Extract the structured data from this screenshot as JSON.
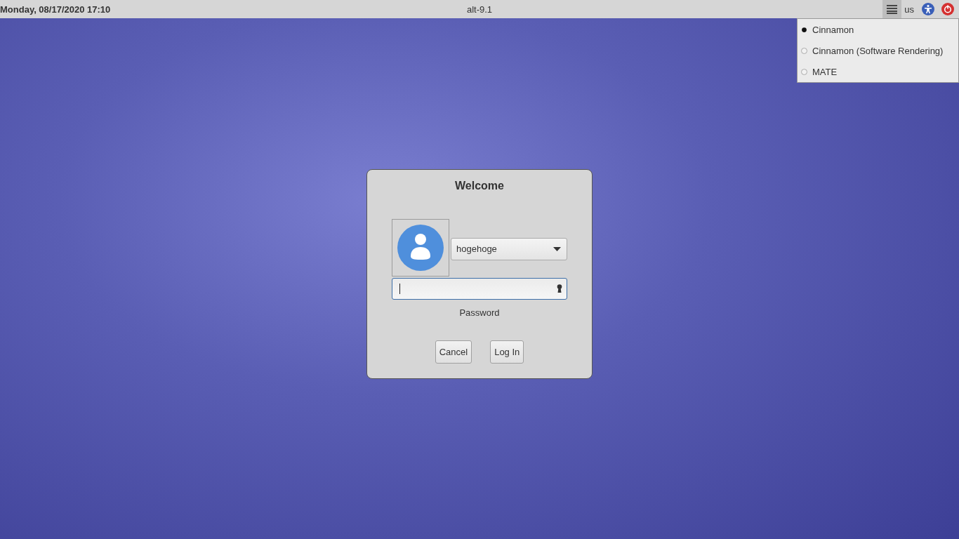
{
  "top_bar": {
    "clock": "Monday, 08/17/2020 17:10",
    "hostname": "alt-9.1",
    "session_menu_button": {
      "expanded": true
    },
    "keyboard_layout": "us"
  },
  "session_menu": {
    "items": [
      {
        "label": "Cinnamon",
        "selected": true
      },
      {
        "label": "Cinnamon (Software Rendering)",
        "selected": false
      },
      {
        "label": "MATE",
        "selected": false
      }
    ]
  },
  "login_dialog": {
    "title": "Welcome",
    "user": "hogehoge",
    "password_label": "Password",
    "buttons": [
      "Cancel",
      "Log In"
    ]
  }
}
